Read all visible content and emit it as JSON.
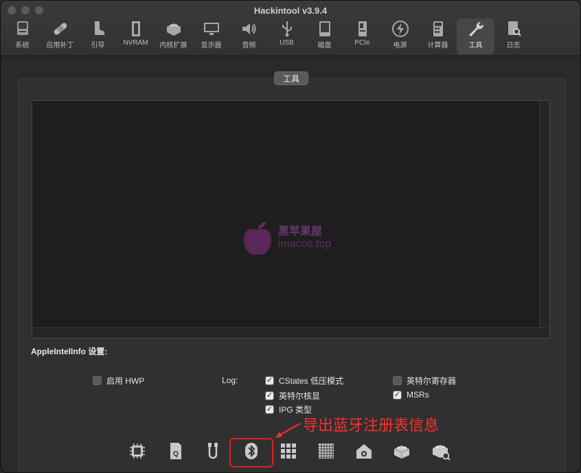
{
  "window": {
    "title": "Hackintool v3.9.4"
  },
  "toolbar": {
    "items": [
      {
        "label": "系统",
        "icon": "computer-icon"
      },
      {
        "label": "应用补丁",
        "icon": "bandage-icon"
      },
      {
        "label": "引导",
        "icon": "boot-icon"
      },
      {
        "label": "NVRAM",
        "icon": "nvram-chip-icon"
      },
      {
        "label": "内核扩展",
        "icon": "lego-brick-icon"
      },
      {
        "label": "显示器",
        "icon": "display-icon"
      },
      {
        "label": "音频",
        "icon": "speaker-icon"
      },
      {
        "label": "USB",
        "icon": "usb-icon"
      },
      {
        "label": "磁盘",
        "icon": "disk-icon"
      },
      {
        "label": "PCIe",
        "icon": "pcie-card-icon"
      },
      {
        "label": "电源",
        "icon": "lightning-icon"
      },
      {
        "label": "计算器",
        "icon": "calculator-icon"
      },
      {
        "label": "工具",
        "icon": "wrench-icon"
      },
      {
        "label": "日志",
        "icon": "log-search-icon"
      }
    ],
    "active_index": 12
  },
  "section": {
    "tab_label": "工具"
  },
  "watermark": {
    "line1": "黑苹果屋",
    "line2": "imacos.top"
  },
  "settings": {
    "label": "AppleIntelInfo 设置:",
    "hwp": {
      "label": "启用 HWP",
      "checked": false
    },
    "log_label": "Log:",
    "log_options": [
      {
        "label": "CStates 低压模式",
        "checked": true
      },
      {
        "label": "英特尔核显",
        "checked": true
      },
      {
        "label": "IPG 类型",
        "checked": true
      },
      {
        "label": "英特尔寄存器",
        "checked": false
      },
      {
        "label": "MSRs",
        "checked": true
      }
    ]
  },
  "tools": [
    {
      "icon": "cpu-chip-icon"
    },
    {
      "icon": "sd-card-q-icon"
    },
    {
      "icon": "cable-connector-icon"
    },
    {
      "icon": "bluetooth-icon"
    },
    {
      "icon": "grid-apps-icon"
    },
    {
      "icon": "memory-grid-icon"
    },
    {
      "icon": "home-camera-icon"
    },
    {
      "icon": "lego-brick-icon"
    },
    {
      "icon": "lego-brick-search-icon"
    }
  ],
  "annotation": {
    "text": "导出蓝牙注册表信息",
    "color": "#ff2d2d"
  }
}
